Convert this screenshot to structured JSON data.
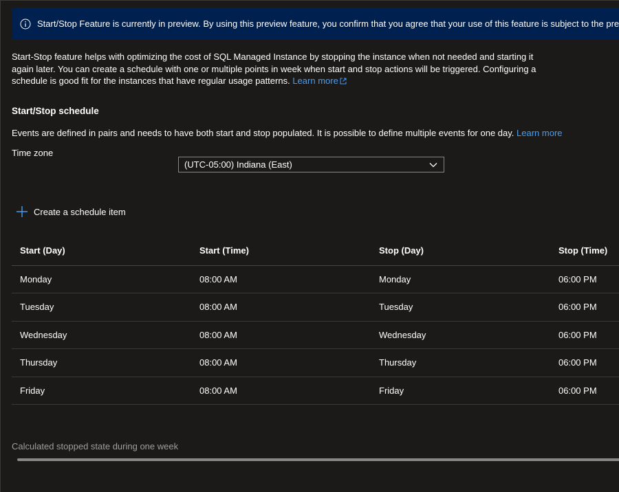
{
  "banner": {
    "text": "Start/Stop Feature is currently in preview. By using this preview feature, you confirm that you agree that your use of this feature is subject to the preview terms in the a",
    "icon": "info-icon"
  },
  "description": {
    "text": "Start-Stop feature helps with optimizing the cost of SQL Managed Instance by stopping the instance when not needed and starting it again later. You can create a schedule with one or multiple points in week when start and stop actions will be triggered. Configuring a schedule is good fit for the instances that have regular usage patterns.",
    "learn_more": "Learn more"
  },
  "schedule": {
    "title": "Start/Stop schedule",
    "events_text": "Events are defined in pairs and needs to have both start and stop populated. It is possible to define multiple events for one day.",
    "learn_more": "Learn more",
    "timezone_label": "Time zone",
    "timezone_value": "(UTC-05:00) Indiana (East)",
    "create_label": "Create a schedule item"
  },
  "table": {
    "headers": [
      "Start (Day)",
      "Start (Time)",
      "Stop (Day)",
      "Stop (Time)"
    ],
    "rows": [
      [
        "Monday",
        "08:00 AM",
        "Monday",
        "06:00 PM"
      ],
      [
        "Tuesday",
        "08:00 AM",
        "Tuesday",
        "06:00 PM"
      ],
      [
        "Wednesday",
        "08:00 AM",
        "Wednesday",
        "06:00 PM"
      ],
      [
        "Thursday",
        "08:00 AM",
        "Thursday",
        "06:00 PM"
      ],
      [
        "Friday",
        "08:00 AM",
        "Friday",
        "06:00 PM"
      ]
    ]
  },
  "calculated": {
    "label": "Calculated stopped state during one week"
  },
  "colors": {
    "background": "#1b1a19",
    "banner": "#002050",
    "link": "#479ef5",
    "accent": "#479ef5"
  }
}
